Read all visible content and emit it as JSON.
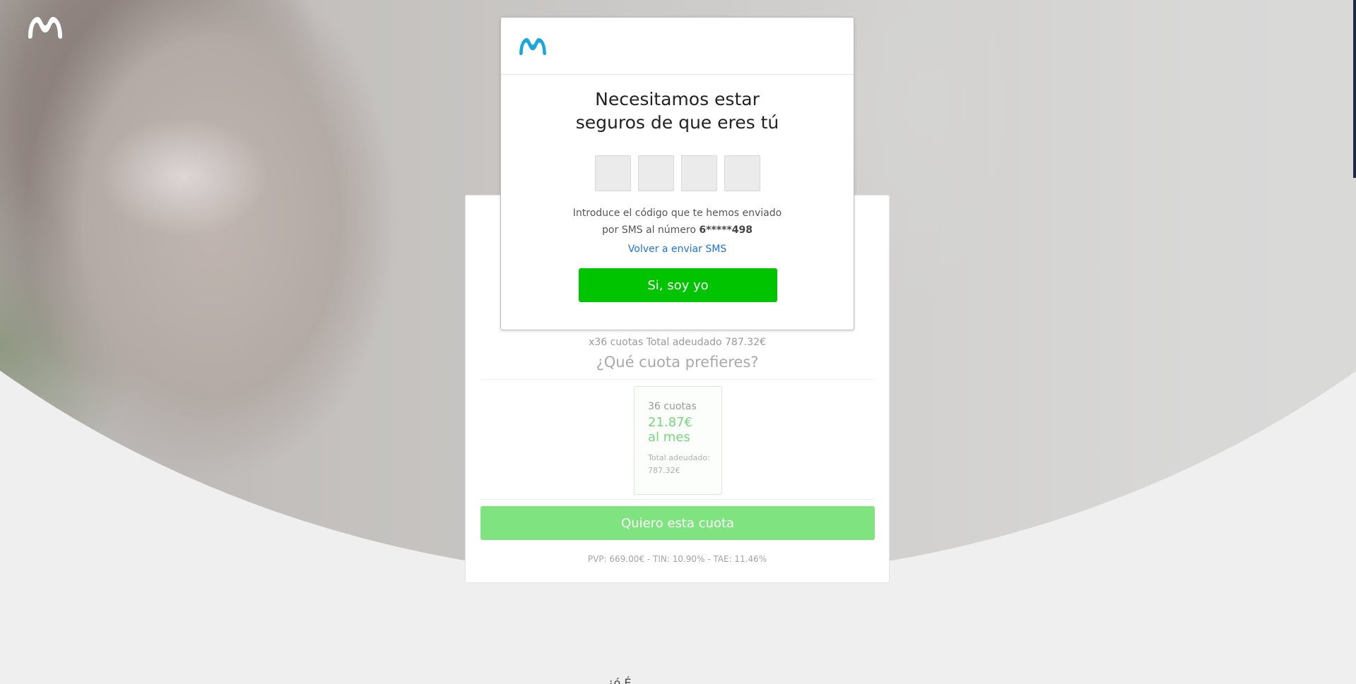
{
  "brand": {
    "logo_icon": "movistar-m-icon",
    "accent": "#00c400",
    "logo_color_light": "#ffffff",
    "logo_color_brand": "#1ba6e0"
  },
  "modal": {
    "title_line1": "Necesitamos estar",
    "title_line2": "seguros de que eres tú",
    "code_length": 4,
    "instructions_line1": "Introduce el código que te hemos enviado",
    "instructions_prefix": "por SMS al número ",
    "phone_masked": "6*****498",
    "resend_label": "Volver a enviar SMS",
    "confirm_label": "Si, soy yo"
  },
  "product": {
    "summary": "x36 cuotas Total adeudado 787.32€",
    "question": "¿Qué cuota prefieres?",
    "plan": {
      "installments": "36 cuotas",
      "amount": "21.87€",
      "per": "al mes",
      "total_label": "Total adeudado:",
      "total_value": "787.32€"
    },
    "button_label": "Quiero esta cuota",
    "legal": "PVP: 669.00€ - TIN: 10.90% - TAE: 11.46%"
  },
  "footer_peek": "¿ó É"
}
